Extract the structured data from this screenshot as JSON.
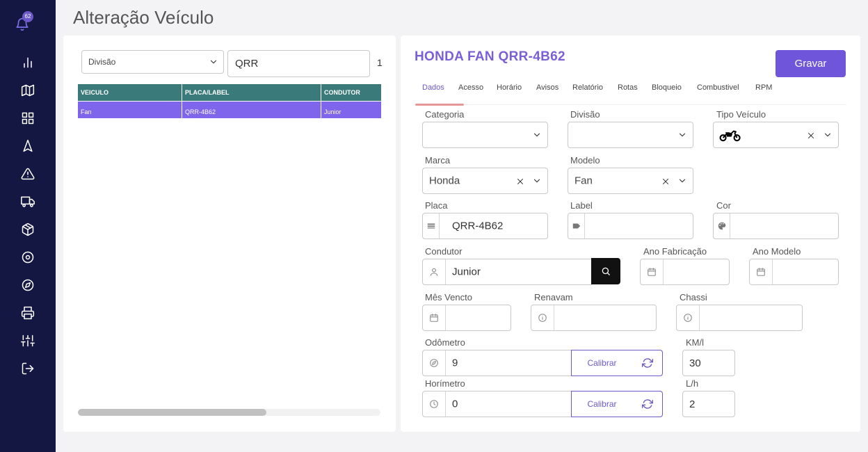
{
  "page": {
    "title": "Alteração Veículo"
  },
  "notifications": {
    "count": "62"
  },
  "sidebar": {
    "items": [
      {
        "name": "chart-icon"
      },
      {
        "name": "map-icon"
      },
      {
        "name": "dashboard-grid-icon"
      },
      {
        "name": "navigation-icon"
      },
      {
        "name": "alert-triangle-icon"
      },
      {
        "name": "truck-icon"
      },
      {
        "name": "package-icon"
      },
      {
        "name": "disc-icon"
      },
      {
        "name": "compass-icon"
      },
      {
        "name": "printer-icon"
      },
      {
        "name": "sliders-icon"
      },
      {
        "name": "logout-icon"
      }
    ]
  },
  "filter": {
    "division_value": "Divisão",
    "search_value": "QRR",
    "result_count": "1"
  },
  "grid": {
    "columns": [
      "VEICULO",
      "PLACA/LABEL",
      "CONDUTOR"
    ],
    "rows": [
      {
        "veiculo": "Fan",
        "placa": "QRR-4B62",
        "condutor": "Junior"
      }
    ]
  },
  "vehicle": {
    "title": "HONDA FAN QRR-4B62",
    "save_label": "Gravar"
  },
  "tabs": [
    {
      "label": "Dados",
      "active": true
    },
    {
      "label": "Acesso"
    },
    {
      "label": "Horário"
    },
    {
      "label": "Avisos"
    },
    {
      "label": "Relatório"
    },
    {
      "label": "Rotas"
    },
    {
      "label": "Bloqueio"
    },
    {
      "label": "Combustivel"
    },
    {
      "label": "RPM"
    }
  ],
  "form": {
    "categoria": {
      "label": "Categoria",
      "value": ""
    },
    "divisao": {
      "label": "Divisão",
      "value": ""
    },
    "tipo_veiculo": {
      "label": "Tipo Veículo",
      "icon": "motorcycle-icon"
    },
    "marca": {
      "label": "Marca",
      "value": "Honda"
    },
    "modelo": {
      "label": "Modelo",
      "value": "Fan"
    },
    "placa": {
      "label": "Placa",
      "value": "QRR-4B62"
    },
    "label_field": {
      "label": "Label",
      "value": ""
    },
    "cor": {
      "label": "Cor",
      "value": ""
    },
    "condutor": {
      "label": "Condutor",
      "value": "Junior"
    },
    "ano_fabricacao": {
      "label": "Ano Fabricação",
      "value": ""
    },
    "ano_modelo": {
      "label": "Ano Modelo",
      "value": ""
    },
    "mes_vencto": {
      "label": "Mês Vencto",
      "value": ""
    },
    "renavam": {
      "label": "Renavam",
      "value": ""
    },
    "chassi": {
      "label": "Chassi",
      "value": ""
    },
    "odometro": {
      "label": "Odômetro",
      "value": "9",
      "calibrate_label": "Calibrar"
    },
    "km_l": {
      "label": "KM/l",
      "value": "30"
    },
    "horimetro": {
      "label": "Horímetro",
      "value": "0",
      "calibrate_label": "Calibrar"
    },
    "l_h": {
      "label": "L/h",
      "value": "2"
    }
  },
  "colors": {
    "sidebar_bg": "#141741",
    "accent": "#6f55d9",
    "grid_header": "#3b7a7a",
    "grid_selected_row": "#7f64ec",
    "tab_underline": "#e79797"
  }
}
